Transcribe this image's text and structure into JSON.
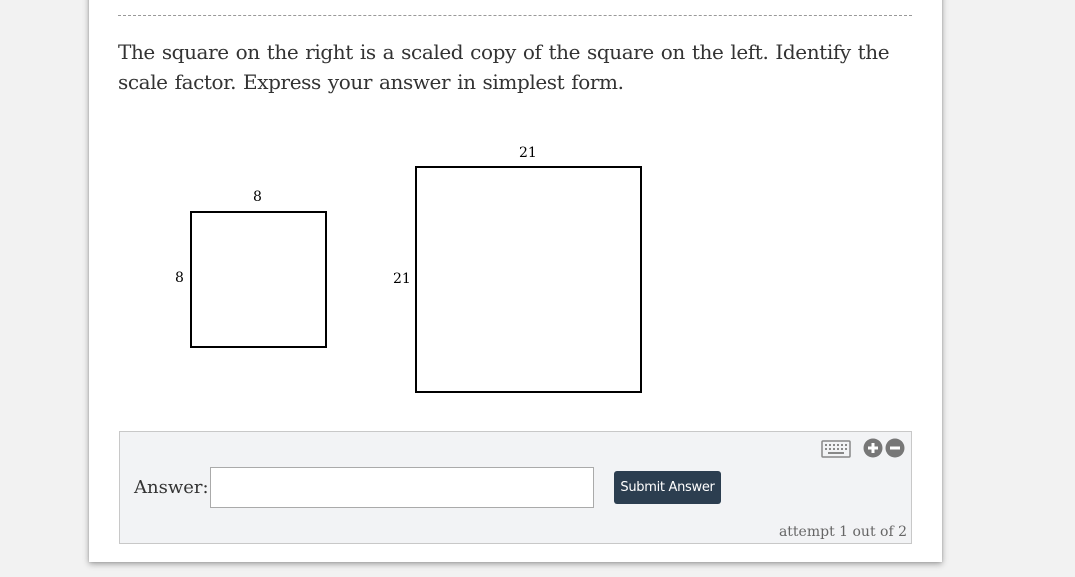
{
  "question": {
    "text": "The square on the right is a scaled copy of the square on the left. Identify the scale factor. Express your answer in simplest form."
  },
  "figure": {
    "left_square": {
      "top_label": "8",
      "side_label": "8"
    },
    "right_square": {
      "top_label": "21",
      "side_label": "21"
    }
  },
  "answer": {
    "label": "Answer:",
    "input_value": "",
    "submit_label": "Submit Answer",
    "attempt_text": "attempt 1 out of 2"
  },
  "tools": {
    "keyboard_icon": "keyboard-icon",
    "zoom_in_icon": "zoom-in-icon",
    "zoom_out_icon": "zoom-out-icon"
  },
  "colors": {
    "button_bg": "#2c3e50",
    "answer_box_bg": "#f2f3f5",
    "icon_gray": "#777777"
  }
}
